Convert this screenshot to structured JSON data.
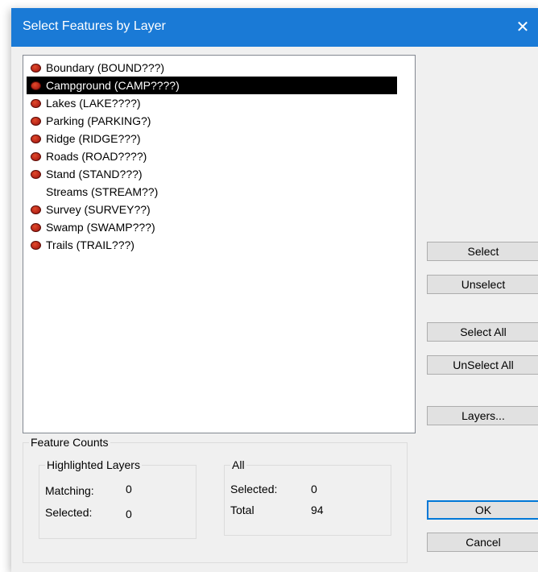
{
  "window": {
    "title": "Select Features by Layer",
    "close_glyph": "✕"
  },
  "layers": [
    {
      "label": "Boundary (BOUND???)",
      "icon": true,
      "selected": false
    },
    {
      "label": "Campground (CAMP????)",
      "icon": true,
      "selected": true
    },
    {
      "label": "Lakes (LAKE????)",
      "icon": true,
      "selected": false
    },
    {
      "label": "Parking (PARKING?)",
      "icon": true,
      "selected": false
    },
    {
      "label": "Ridge (RIDGE???)",
      "icon": true,
      "selected": false
    },
    {
      "label": "Roads (ROAD????)",
      "icon": true,
      "selected": false
    },
    {
      "label": "Stand (STAND???)",
      "icon": true,
      "selected": false
    },
    {
      "label": "Streams (STREAM??)",
      "icon": false,
      "selected": false
    },
    {
      "label": "Survey (SURVEY??)",
      "icon": true,
      "selected": false
    },
    {
      "label": "Swamp (SWAMP???)",
      "icon": true,
      "selected": false
    },
    {
      "label": "Trails (TRAIL???)",
      "icon": true,
      "selected": false
    }
  ],
  "buttons": {
    "select": "Select",
    "unselect": "Unselect",
    "select_all": "Select All",
    "unselect_all": "UnSelect All",
    "layers": "Layers...",
    "ok": "OK",
    "cancel": "Cancel"
  },
  "feature_counts": {
    "caption": "Feature Counts",
    "highlighted": {
      "caption": "Highlighted Layers",
      "matching_label": "Matching:",
      "matching_value": "0",
      "selected_label": "Selected:",
      "selected_value": "0"
    },
    "all": {
      "caption": "All",
      "selected_label": "Selected:",
      "selected_value": "0",
      "total_label": "Total",
      "total_value": "94"
    }
  },
  "colors": {
    "titlebar": "#1a7ad6",
    "selection": "#000000",
    "layer_icon": "#c0281b"
  }
}
